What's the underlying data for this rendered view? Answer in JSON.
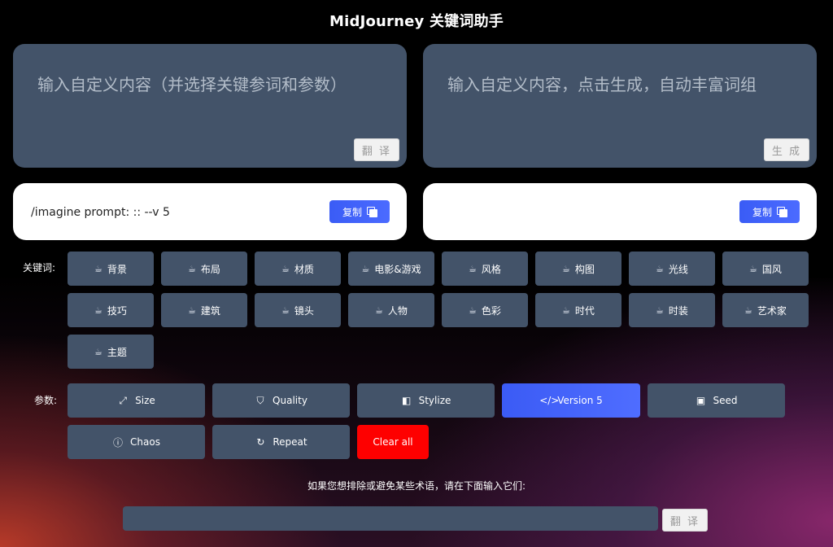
{
  "title": "MidJourney 关键词助手",
  "left_panel": {
    "placeholder": "输入自定义内容（并选择关键参词和参数）",
    "button": "翻 译"
  },
  "right_panel": {
    "placeholder": "输入自定义内容，点击生成，自动丰富词组",
    "button": "生 成"
  },
  "left_output": {
    "text": "/imagine prompt: :: --v 5",
    "copy": "复制"
  },
  "right_output": {
    "text": "",
    "copy": "复制"
  },
  "keywords_label": "关键词:",
  "keywords": [
    "背景",
    "布局",
    "材质",
    "电影&游戏",
    "风格",
    "构图",
    "光线",
    "国风",
    "技巧",
    "建筑",
    "镜头",
    "人物",
    "色彩",
    "时代",
    "时装",
    "艺术家",
    "主题"
  ],
  "params_label": "参数:",
  "params": [
    {
      "label": "Size",
      "icon": "expand-icon",
      "glyph": "⤢"
    },
    {
      "label": "Quality",
      "icon": "shield-icon",
      "glyph": "⛉"
    },
    {
      "label": "Stylize",
      "icon": "palette-icon",
      "glyph": "◧"
    },
    {
      "label": "Version 5",
      "icon": "code-icon",
      "glyph": "</>"
    },
    {
      "label": "Seed",
      "icon": "seed-icon",
      "glyph": "▣"
    },
    {
      "label": "Chaos",
      "icon": "alert-circle-icon",
      "glyph": "ⓘ"
    },
    {
      "label": "Repeat",
      "icon": "repeat-icon",
      "glyph": "↻"
    },
    {
      "label": "Clear all",
      "icon": "",
      "glyph": ""
    }
  ],
  "exclude": {
    "label": "如果您想排除或避免某些术语，请在下面输入它们:",
    "value": "",
    "button": "翻 译"
  },
  "colors": {
    "panel": "#435369",
    "accent": "#3b5bf5",
    "danger": "#fe0000"
  }
}
